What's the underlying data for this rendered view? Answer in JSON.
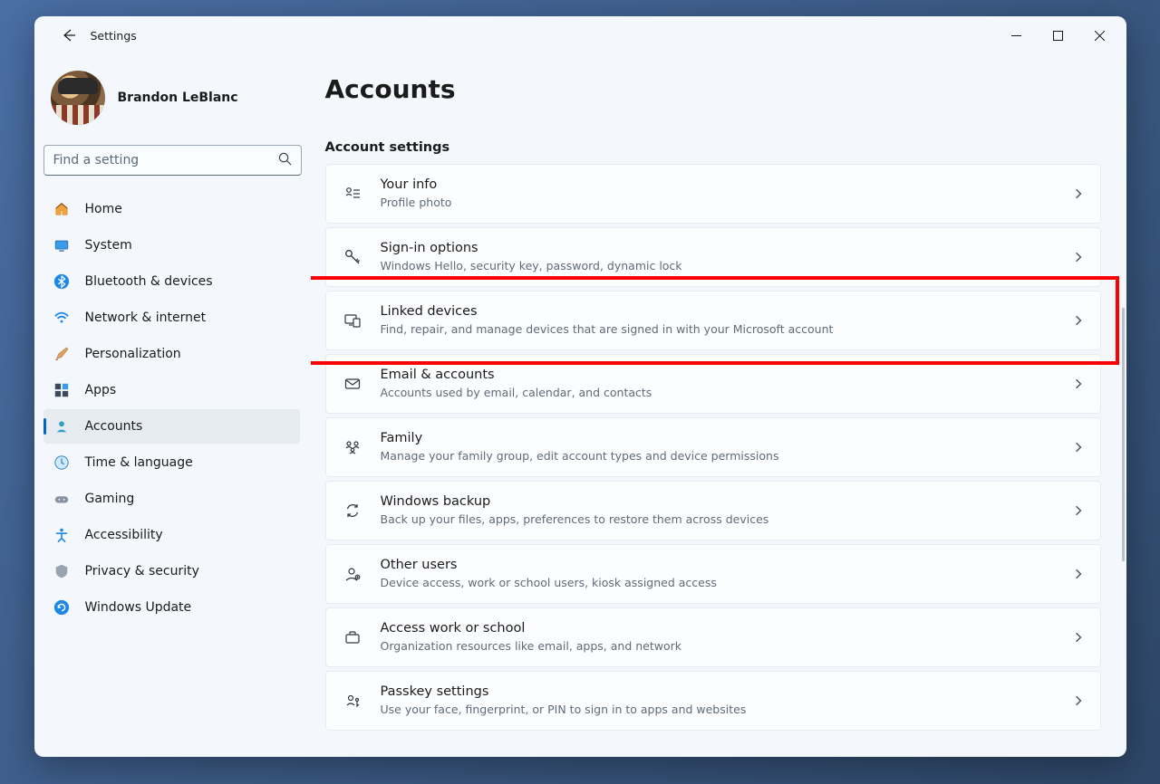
{
  "titlebar": {
    "title": "Settings"
  },
  "profile": {
    "name": "Brandon LeBlanc"
  },
  "search": {
    "placeholder": "Find a setting"
  },
  "sidebar": {
    "items": [
      {
        "label": "Home"
      },
      {
        "label": "System"
      },
      {
        "label": "Bluetooth & devices"
      },
      {
        "label": "Network & internet"
      },
      {
        "label": "Personalization"
      },
      {
        "label": "Apps"
      },
      {
        "label": "Accounts"
      },
      {
        "label": "Time & language"
      },
      {
        "label": "Gaming"
      },
      {
        "label": "Accessibility"
      },
      {
        "label": "Privacy & security"
      },
      {
        "label": "Windows Update"
      }
    ]
  },
  "page": {
    "title": "Accounts",
    "section_label": "Account settings"
  },
  "cards": [
    {
      "title": "Your info",
      "desc": "Profile photo"
    },
    {
      "title": "Sign-in options",
      "desc": "Windows Hello, security key, password, dynamic lock"
    },
    {
      "title": "Linked devices",
      "desc": "Find, repair, and manage devices that are signed in with your Microsoft account"
    },
    {
      "title": "Email & accounts",
      "desc": "Accounts used by email, calendar, and contacts"
    },
    {
      "title": "Family",
      "desc": "Manage your family group, edit account types and device permissions"
    },
    {
      "title": "Windows backup",
      "desc": "Back up your files, apps, preferences to restore them across devices"
    },
    {
      "title": "Other users",
      "desc": "Device access, work or school users, kiosk assigned access"
    },
    {
      "title": "Access work or school",
      "desc": "Organization resources like email, apps, and network"
    },
    {
      "title": "Passkey settings",
      "desc": "Use your face, fingerprint, or PIN to sign in to apps and websites"
    }
  ]
}
